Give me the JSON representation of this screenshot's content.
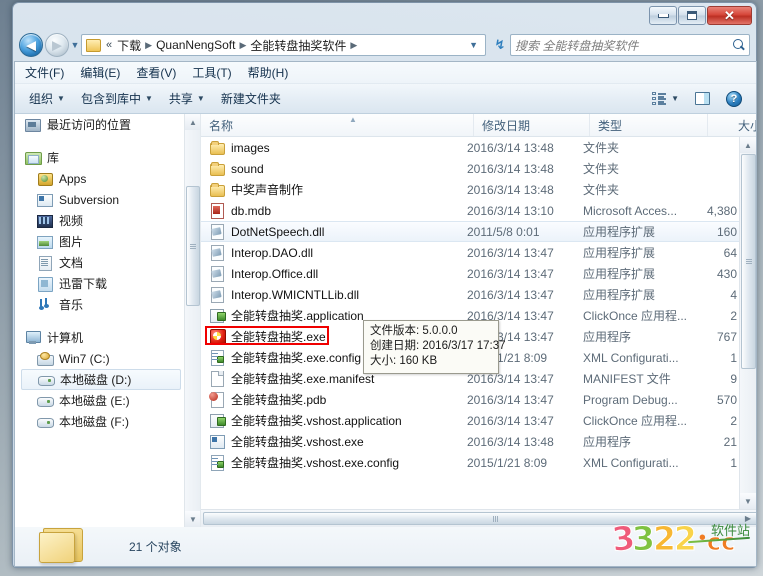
{
  "window": {
    "controls": {
      "minimize": "–",
      "maximize": "□",
      "close": "✕"
    }
  },
  "nav": {
    "back_label": "◀",
    "forward_label": "▶",
    "history_caret": "▼",
    "breadcrumb_prefix": "«",
    "breadcrumbs": [
      "下载",
      "QuanNengSoft",
      "全能转盘抽奖软件"
    ],
    "chevron": "▶",
    "address_caret": "▼",
    "refresh_label": "↯"
  },
  "search": {
    "placeholder": "搜索 全能转盘抽奖软件",
    "icon": "search-icon"
  },
  "menubar": {
    "items": [
      "文件(F)",
      "编辑(E)",
      "查看(V)",
      "工具(T)",
      "帮助(H)"
    ]
  },
  "toolbar": {
    "organize": "组织",
    "include_in_library": "包含到库中",
    "share": "共享",
    "new_folder": "新建文件夹",
    "caret": "▼",
    "help_label": "?"
  },
  "sidebar": {
    "items": [
      {
        "label": "最近访问的位置",
        "icon": "recent-places-icon",
        "indent": false,
        "selected": false
      },
      {
        "label": "库",
        "icon": "library-icon",
        "indent": false,
        "selected": false
      },
      {
        "label": "Apps",
        "icon": "apps-library-icon",
        "indent": true,
        "selected": false
      },
      {
        "label": "Subversion",
        "icon": "subversion-library-icon",
        "indent": true,
        "selected": false
      },
      {
        "label": "视频",
        "icon": "video-library-icon",
        "indent": true,
        "selected": false
      },
      {
        "label": "图片",
        "icon": "pictures-library-icon",
        "indent": true,
        "selected": false
      },
      {
        "label": "文档",
        "icon": "documents-library-icon",
        "indent": true,
        "selected": false
      },
      {
        "label": "迅雷下载",
        "icon": "thunder-download-icon",
        "indent": true,
        "selected": false
      },
      {
        "label": "音乐",
        "icon": "music-library-icon",
        "indent": true,
        "selected": false
      },
      {
        "label": "计算机",
        "icon": "computer-icon",
        "indent": false,
        "selected": false
      },
      {
        "label": "Win7 (C:)",
        "icon": "system-drive-icon",
        "indent": true,
        "selected": false
      },
      {
        "label": "本地磁盘 (D:)",
        "icon": "local-disk-icon",
        "indent": true,
        "selected": true
      },
      {
        "label": "本地磁盘 (E:)",
        "icon": "local-disk-icon",
        "indent": true,
        "selected": false
      },
      {
        "label": "本地磁盘 (F:)",
        "icon": "local-disk-icon",
        "indent": true,
        "selected": false
      }
    ]
  },
  "filelist": {
    "columns": [
      {
        "key": "name",
        "label": "名称"
      },
      {
        "key": "date",
        "label": "修改日期"
      },
      {
        "key": "type",
        "label": "类型"
      },
      {
        "key": "size",
        "label": "大小"
      }
    ],
    "sort_arrow": "▲",
    "rows": [
      {
        "name": "images",
        "date": "2016/3/14 13:48",
        "type": "文件夹",
        "size": "",
        "icon": "folder-icon",
        "selected": false,
        "annotated": false
      },
      {
        "name": "sound",
        "date": "2016/3/14 13:48",
        "type": "文件夹",
        "size": "",
        "icon": "folder-icon",
        "selected": false,
        "annotated": false
      },
      {
        "name": "中奖声音制作",
        "date": "2016/3/14 13:48",
        "type": "文件夹",
        "size": "",
        "icon": "folder-icon",
        "selected": false,
        "annotated": false
      },
      {
        "name": "db.mdb",
        "date": "2016/3/14 13:10",
        "type": "Microsoft Acces...",
        "size": "4,380",
        "icon": "access-database-icon",
        "selected": false,
        "annotated": false
      },
      {
        "name": "DotNetSpeech.dll",
        "date": "2011/5/8 0:01",
        "type": "应用程序扩展",
        "size": "160",
        "icon": "dll-icon",
        "selected": true,
        "annotated": false
      },
      {
        "name": "Interop.DAO.dll",
        "date": "2016/3/14 13:47",
        "type": "应用程序扩展",
        "size": "64",
        "icon": "dll-icon",
        "selected": false,
        "annotated": false
      },
      {
        "name": "Interop.Office.dll",
        "date": "2016/3/14 13:47",
        "type": "应用程序扩展",
        "size": "430",
        "icon": "dll-icon",
        "selected": false,
        "annotated": false
      },
      {
        "name": "Interop.WMICNTLLib.dll",
        "date": "2016/3/14 13:47",
        "type": "应用程序扩展",
        "size": "4",
        "icon": "dll-icon",
        "selected": false,
        "annotated": false
      },
      {
        "name": "全能转盘抽奖.application",
        "date": "2016/3/14 13:47",
        "type": "ClickOnce 应用程...",
        "size": "2",
        "icon": "clickonce-application-icon",
        "selected": false,
        "annotated": false
      },
      {
        "name": "全能转盘抽奖.exe",
        "date": "2016/3/14 13:47",
        "type": "应用程序",
        "size": "767",
        "icon": "lottery-exe-icon",
        "selected": false,
        "annotated": true
      },
      {
        "name": "全能转盘抽奖.exe.config",
        "date": "2015/1/21 8:09",
        "type": "XML Configurati...",
        "size": "1",
        "icon": "xml-config-icon",
        "selected": false,
        "annotated": false
      },
      {
        "name": "全能转盘抽奖.exe.manifest",
        "date": "2016/3/14 13:47",
        "type": "MANIFEST 文件",
        "size": "9",
        "icon": "manifest-file-icon",
        "selected": false,
        "annotated": false
      },
      {
        "name": "全能转盘抽奖.pdb",
        "date": "2016/3/14 13:47",
        "type": "Program Debug...",
        "size": "570",
        "icon": "pdb-icon",
        "selected": false,
        "annotated": false
      },
      {
        "name": "全能转盘抽奖.vshost.application",
        "date": "2016/3/14 13:47",
        "type": "ClickOnce 应用程...",
        "size": "2",
        "icon": "clickonce-application-icon",
        "selected": false,
        "annotated": false
      },
      {
        "name": "全能转盘抽奖.vshost.exe",
        "date": "2016/3/14 13:48",
        "type": "应用程序",
        "size": "21",
        "icon": "vshost-exe-icon",
        "selected": false,
        "annotated": false
      },
      {
        "name": "全能转盘抽奖.vshost.exe.config",
        "date": "2015/1/21 8:09",
        "type": "XML Configurati...",
        "size": "1",
        "icon": "xml-config-icon",
        "selected": false,
        "annotated": false
      }
    ]
  },
  "tooltip": {
    "file_version": "文件版本: 5.0.0.0",
    "created_date": "创建日期: 2016/3/17 17:37",
    "size": "大小: 160 KB"
  },
  "statusbar": {
    "text": "21 个对象",
    "folder_icon": "large-folder-icon"
  },
  "watermark": {
    "digits": [
      "3",
      "3",
      "2",
      "2"
    ],
    "dot": "•",
    "tld": "cc",
    "tagline": "软件站"
  },
  "colors": {
    "accent": "#2f7fbe",
    "annotation": "#ff0000",
    "close_button": "#bc2f23",
    "folder_yellow": "#e9bf52"
  }
}
